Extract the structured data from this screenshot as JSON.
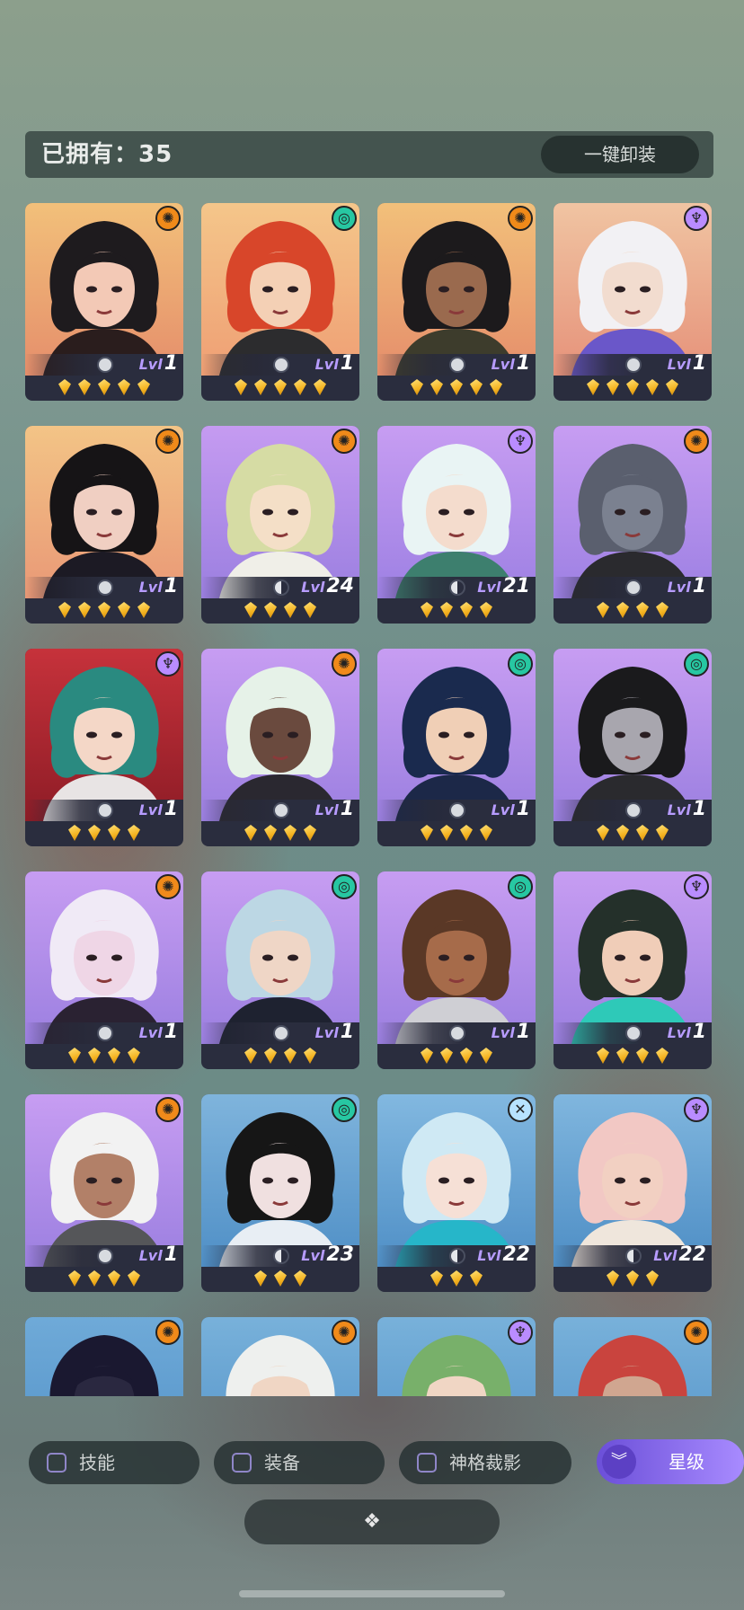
{
  "header": {
    "owned_label": "已拥有：35",
    "unequip_all": "一键卸装"
  },
  "cards": [
    {
      "level": "1",
      "stars": 5,
      "element": "sun",
      "ring": "full",
      "bg": [
        "#f2c07a",
        "#e58e6b"
      ],
      "hair": "#1e1b1e",
      "skin": "#f3c9b6",
      "cloth": "#2a1d1d"
    },
    {
      "level": "1",
      "stars": 5,
      "element": "wave",
      "ring": "full",
      "bg": [
        "#f4c68a",
        "#ef9f74"
      ],
      "hair": "#d8462a",
      "skin": "#f4d0b5",
      "cloth": "#2c2c2e"
    },
    {
      "level": "1",
      "stars": 5,
      "element": "sun",
      "ring": "full",
      "bg": [
        "#f2c07a",
        "#e58e6b"
      ],
      "hair": "#1c1a1c",
      "skin": "#9a6a4e",
      "cloth": "#3d3c2c"
    },
    {
      "level": "1",
      "stars": 5,
      "element": "mind",
      "ring": "full",
      "bg": [
        "#f0c4a2",
        "#e6927a"
      ],
      "hair": "#f2f1f4",
      "skin": "#f2dccf",
      "cloth": "#6a57c9"
    },
    {
      "level": "1",
      "stars": 5,
      "element": "sun",
      "ring": "full",
      "bg": [
        "#f3c486",
        "#e99876"
      ],
      "hair": "#161416",
      "skin": "#f0cfc2",
      "cloth": "#1c1a24"
    },
    {
      "level": "24",
      "stars": 4,
      "element": "sun",
      "ring": "half",
      "bg": [
        "#c59bf1",
        "#9b7fe0"
      ],
      "hair": "#d6dca4",
      "skin": "#f4dfc7",
      "cloth": "#f0efe8"
    },
    {
      "level": "21",
      "stars": 4,
      "element": "mind",
      "ring": "half",
      "bg": [
        "#c79df2",
        "#9d80e3"
      ],
      "hair": "#e9f4f4",
      "skin": "#f4dccd",
      "cloth": "#3d7f6e"
    },
    {
      "level": "1",
      "stars": 4,
      "element": "sun",
      "ring": "full",
      "bg": [
        "#c79df2",
        "#9d80e3"
      ],
      "hair": "#5a5f6e",
      "skin": "#7b8190",
      "cloth": "#2a2a2e"
    },
    {
      "level": "1",
      "stars": 4,
      "element": "mind",
      "ring": "full",
      "bg": [
        "#c6323b",
        "#8e1c26"
      ],
      "hair": "#2a8a80",
      "skin": "#f4d7c7",
      "cloth": "#e8e4e4"
    },
    {
      "level": "1",
      "stars": 4,
      "element": "sun",
      "ring": "full",
      "bg": [
        "#c79df2",
        "#9b7fe0"
      ],
      "hair": "#e6f2e8",
      "skin": "#6a4a3e",
      "cloth": "#2a2830"
    },
    {
      "level": "1",
      "stars": 4,
      "element": "wave",
      "ring": "full",
      "bg": [
        "#c79df2",
        "#9b7fe0"
      ],
      "hair": "#1a2a4e",
      "skin": "#f0cfb6",
      "cloth": "#1c2848"
    },
    {
      "level": "1",
      "stars": 4,
      "element": "wave",
      "ring": "full",
      "bg": [
        "#c79df2",
        "#9b7fe0"
      ],
      "hair": "#1a1a1c",
      "skin": "#a8a6ae",
      "cloth": "#2a2a2e"
    },
    {
      "level": "1",
      "stars": 4,
      "element": "sun",
      "ring": "full",
      "bg": [
        "#c79df2",
        "#9b7fe0"
      ],
      "hair": "#f0eaf6",
      "skin": "#efd6e6",
      "cloth": "#2a2232"
    },
    {
      "level": "1",
      "stars": 4,
      "element": "wave",
      "ring": "full",
      "bg": [
        "#c79df2",
        "#9b7fe0"
      ],
      "hair": "#bcd7e4",
      "skin": "#efd6c6",
      "cloth": "#1e2230"
    },
    {
      "level": "1",
      "stars": 4,
      "element": "wave",
      "ring": "full",
      "bg": [
        "#c79df2",
        "#9b7fe0"
      ],
      "hair": "#5a3826",
      "skin": "#a66b4a",
      "cloth": "#cfcfd4"
    },
    {
      "level": "1",
      "stars": 4,
      "element": "mind",
      "ring": "full",
      "bg": [
        "#c79df2",
        "#9b7fe0"
      ],
      "hair": "#24302a",
      "skin": "#f0cdb8",
      "cloth": "#2ec9b8"
    },
    {
      "level": "1",
      "stars": 4,
      "element": "sun",
      "ring": "full",
      "bg": [
        "#c79df2",
        "#9b7fe0"
      ],
      "hair": "#f2f2f2",
      "skin": "#b28068",
      "cloth": "#555659"
    },
    {
      "level": "23",
      "stars": 3,
      "element": "wave",
      "ring": "half",
      "bg": [
        "#7fb4dc",
        "#4f8fc6"
      ],
      "hair": "#161616",
      "skin": "#f0e0e0",
      "cloth": "#e8eef4"
    },
    {
      "level": "22",
      "stars": 3,
      "element": "cross",
      "ring": "half",
      "bg": [
        "#82b8e0",
        "#4f8fc6"
      ],
      "hair": "#cfe9f4",
      "skin": "#f6e0d6",
      "cloth": "#26b6c9"
    },
    {
      "level": "22",
      "stars": 3,
      "element": "mind",
      "ring": "half",
      "bg": [
        "#80b6de",
        "#4e8ec5"
      ],
      "hair": "#f2c8c4",
      "skin": "#f2d0c2",
      "cloth": "#efe6dc"
    },
    {
      "level": "",
      "stars": 0,
      "element": "sun",
      "ring": "none",
      "bg": [
        "#6faad8",
        "#4f8fc6"
      ],
      "hair": "#1a1830",
      "skin": "#2a2840",
      "cloth": "#1a1830"
    },
    {
      "level": "",
      "stars": 0,
      "element": "sun",
      "ring": "none",
      "bg": [
        "#78b1da",
        "#4f8fc6"
      ],
      "hair": "#eef0ee",
      "skin": "#f0d6c4",
      "cloth": "#2a2a2a"
    },
    {
      "level": "",
      "stars": 0,
      "element": "mind",
      "ring": "none",
      "bg": [
        "#78b1da",
        "#4f8fc6"
      ],
      "hair": "#78b06a",
      "skin": "#f0d6c4",
      "cloth": "#2a2a2a"
    },
    {
      "level": "",
      "stars": 0,
      "element": "sun",
      "ring": "none",
      "bg": [
        "#78b1da",
        "#4f8fc6"
      ],
      "hair": "#c9443e",
      "skin": "#d0a690",
      "cloth": "#2a2a2a"
    }
  ],
  "level_prefix": "Lvl",
  "filters": {
    "skill": "技能",
    "equipment": "装备",
    "divinity_shadow": "神格裁影",
    "star_level": "星级"
  },
  "bottom_button_glyph": "❖",
  "element_glyphs": {
    "sun": "✺",
    "wave": "◎",
    "mind": "♆",
    "cross": "✕"
  }
}
